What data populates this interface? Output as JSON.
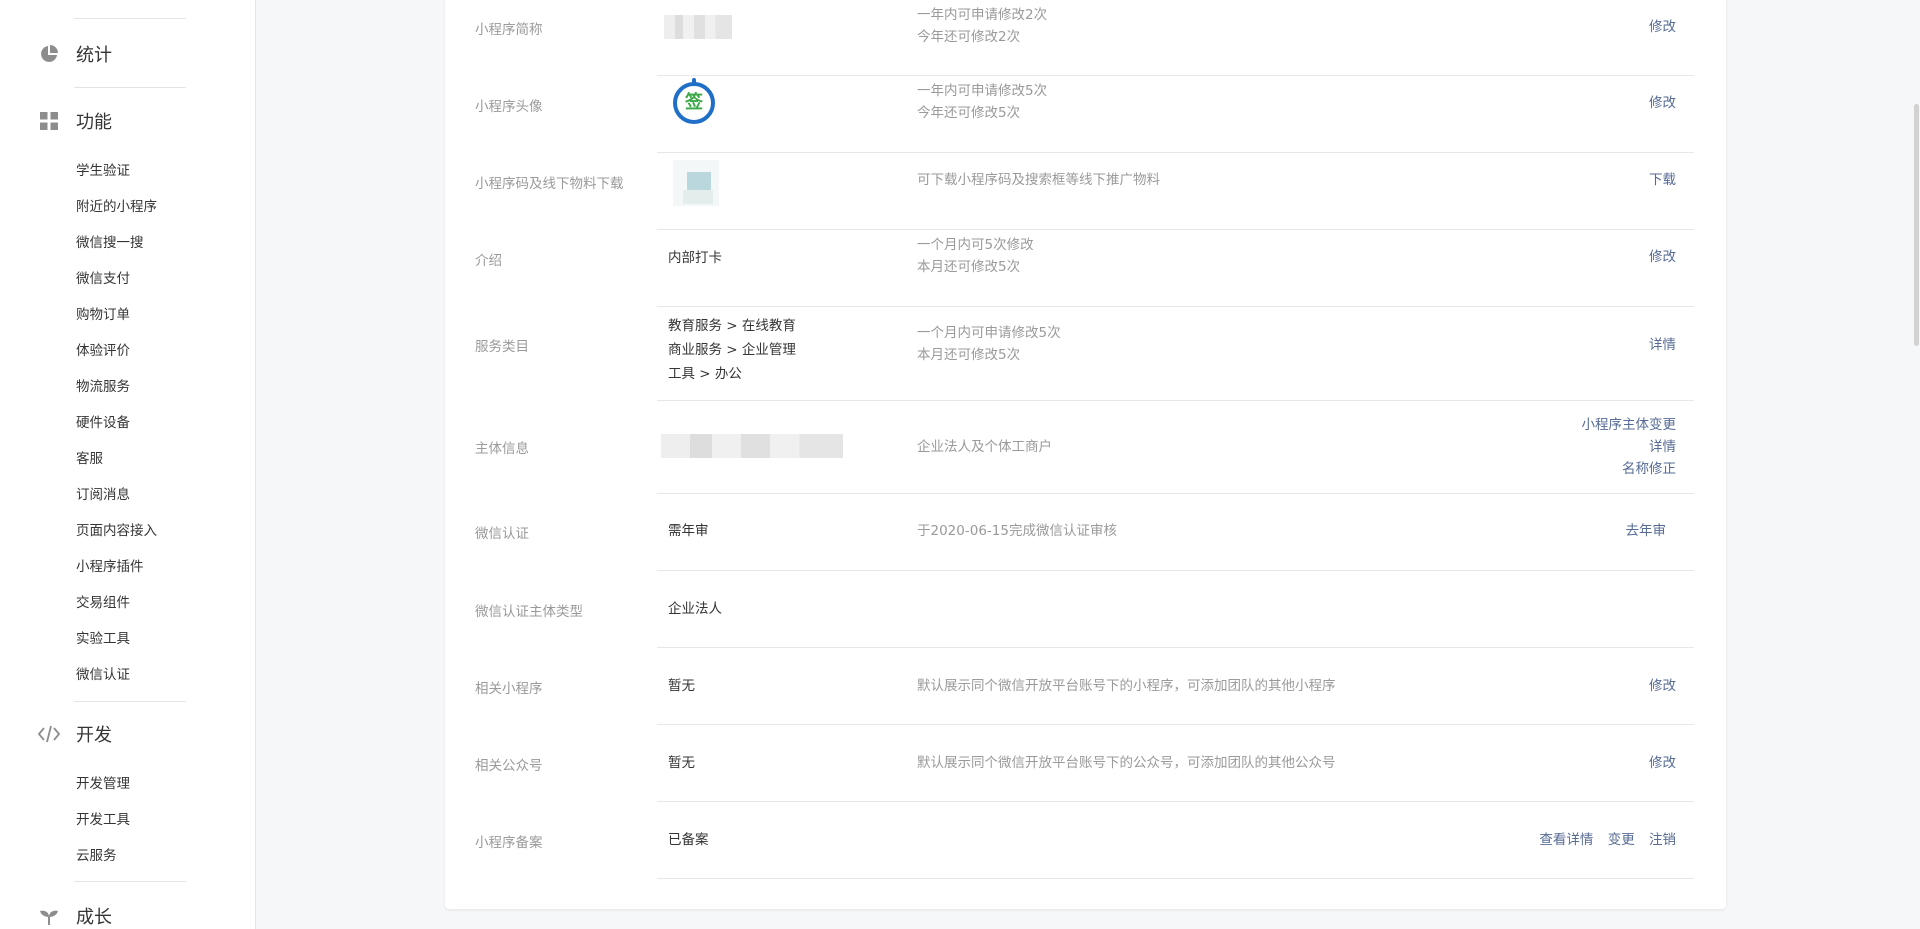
{
  "sidebar": {
    "sections": [
      {
        "label": "统计",
        "icon": "pie-chart-icon"
      },
      {
        "label": "功能",
        "icon": "grid-icon"
      },
      {
        "label": "开发",
        "icon": "code-icon"
      },
      {
        "label": "成长",
        "icon": "sprout-icon"
      }
    ],
    "function_items": [
      "学生验证",
      "附近的小程序",
      "微信搜一搜",
      "微信支付",
      "购物订单",
      "体验评价",
      "物流服务",
      "硬件设备",
      "客服",
      "订阅消息",
      "页面内容接入",
      "小程序插件",
      "交易组件",
      "实验工具",
      "微信认证"
    ],
    "dev_items": [
      "开发管理",
      "开发工具",
      "云服务"
    ]
  },
  "rows": {
    "short_name": {
      "label": "小程序简称",
      "desc": [
        "一年内可申请修改2次",
        "今年还可修改2次"
      ],
      "action": "修改"
    },
    "avatar": {
      "label": "小程序头像",
      "avatar_char": "签",
      "desc": [
        "一年内可申请修改5次",
        "今年还可修改5次"
      ],
      "action": "修改"
    },
    "qrcode": {
      "label": "小程序码及线下物料下载",
      "desc": [
        "可下载小程序码及搜索框等线下推广物料"
      ],
      "action": "下载"
    },
    "intro": {
      "label": "介绍",
      "value": "内部打卡",
      "desc": [
        "一个月内可5次修改",
        "本月还可修改5次"
      ],
      "action": "修改"
    },
    "category": {
      "label": "服务类目",
      "values": [
        "教育服务 > 在线教育",
        "商业服务 > 企业管理",
        "工具 > 办公"
      ],
      "desc": [
        "一个月内可申请修改5次",
        "本月还可修改5次"
      ],
      "action": "详情"
    },
    "subject": {
      "label": "主体信息",
      "desc": [
        "企业法人及个体工商户"
      ],
      "actions": [
        "小程序主体变更",
        "详情",
        "名称修正"
      ]
    },
    "wechat_cert": {
      "label": "微信认证",
      "value": "需年审",
      "desc": [
        "于2020-06-15完成微信认证审核"
      ],
      "action": "去年审"
    },
    "cert_type": {
      "label": "微信认证主体类型",
      "value": "企业法人"
    },
    "related_mp": {
      "label": "相关小程序",
      "value": "暂无",
      "desc": [
        "默认展示同个微信开放平台账号下的小程序，可添加团队的其他小程序"
      ],
      "action": "修改"
    },
    "related_oa": {
      "label": "相关公众号",
      "value": "暂无",
      "desc": [
        "默认展示同个微信开放平台账号下的公众号，可添加团队的其他公众号"
      ],
      "action": "修改"
    },
    "filing": {
      "label": "小程序备案",
      "value": "已备案",
      "actions": [
        "查看详情",
        "变更",
        "注销"
      ]
    }
  },
  "colors": {
    "link": "#576b95",
    "muted": "#9a9a9a",
    "text": "#353535",
    "avatar_ring": "#1f6fc9",
    "avatar_char": "#3aa845"
  }
}
